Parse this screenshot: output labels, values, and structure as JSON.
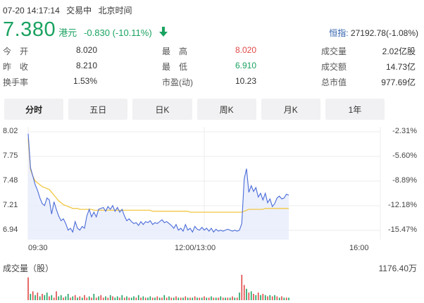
{
  "status": {
    "datetime": "07-20 14:17:14",
    "state": "交易中",
    "timezone": "北京时间"
  },
  "quote": {
    "price": "7.380",
    "currency": "港元",
    "change": "-0.830 (-10.11%)",
    "direction": "down",
    "color_down": "#1aa260"
  },
  "index": {
    "label": "恒指:",
    "value": "27192.78(-1.08%)"
  },
  "stats": {
    "open": {
      "label": "今　开",
      "value": "8.020"
    },
    "prev_close": {
      "label": "昨　收",
      "value": "8.210"
    },
    "turnover_rate": {
      "label": "换手率",
      "value": "1.53%"
    },
    "high": {
      "label": "最　高",
      "value": "8.020"
    },
    "low": {
      "label": "最　低",
      "value": "6.910"
    },
    "pe": {
      "label": "市盈(动)",
      "value": "10.23"
    },
    "volume": {
      "label": "成交量",
      "value": "2.02亿股"
    },
    "amount": {
      "label": "成交额",
      "value": "14.73亿"
    },
    "market_cap": {
      "label": "总市值",
      "value": "977.69亿"
    }
  },
  "tabs": [
    {
      "label": "分时",
      "active": true
    },
    {
      "label": "五日",
      "active": false
    },
    {
      "label": "日K",
      "active": false
    },
    {
      "label": "周K",
      "active": false
    },
    {
      "label": "月K",
      "active": false
    },
    {
      "label": "1年",
      "active": false
    }
  ],
  "chart_data": {
    "type": "line",
    "title": "",
    "x_ticks": [
      "09:30",
      "12:00/13:00",
      "16:00"
    ],
    "y_ticks_left": [
      "8.02",
      "7.75",
      "7.48",
      "7.21",
      "6.94"
    ],
    "y_ticks_right": [
      "-2.31%",
      "-5.60%",
      "-8.89%",
      "-12.18%",
      "-15.47%"
    ],
    "ylim": [
      6.94,
      8.02
    ],
    "colors": {
      "price": "#4a6bd8",
      "average": "#f2c744",
      "fill": "#e7ecfb",
      "vol_up": "#e04848",
      "vol_down": "#1aa260"
    },
    "series": [
      {
        "values": [
          8.0,
          7.64,
          7.55,
          7.46,
          7.4,
          7.32,
          7.26,
          7.24,
          7.32,
          7.3,
          7.15,
          7.28,
          7.2,
          7.13,
          7.08,
          7.1,
          7.05,
          6.98,
          7.0,
          6.96,
          7.07,
          7.0,
          6.98,
          7.02,
          7.0,
          7.13,
          7.2,
          7.12,
          7.17,
          7.12,
          7.2,
          7.21,
          7.22,
          7.18,
          7.23,
          7.2,
          7.24,
          7.18,
          7.22,
          7.17,
          7.2,
          7.13,
          7.08,
          7.1,
          7.07,
          7.05,
          7.06,
          7.03,
          7.07,
          7.04,
          7.07,
          7.06,
          7.08,
          7.04,
          7.06,
          7.05,
          7.07,
          7.09,
          7.06,
          7.07,
          7.05,
          7.03,
          7.0,
          7.04,
          6.98,
          7.0,
          6.97,
          7.04,
          6.98,
          7.0,
          6.96,
          7.02,
          6.99,
          6.98,
          7.01,
          6.98,
          7.0,
          6.97,
          7.0,
          6.96,
          6.99,
          6.97,
          6.98,
          6.97,
          6.98,
          6.99,
          6.98,
          6.97,
          6.98,
          6.97,
          6.98,
          7.05,
          7.52,
          7.63,
          7.38,
          7.45,
          7.39,
          7.43,
          7.33,
          7.37,
          7.3,
          7.37,
          7.27,
          7.31,
          7.23,
          7.26,
          7.32,
          7.34,
          7.31,
          7.32,
          7.36,
          7.35
        ]
      },
      {
        "values": [
          7.95,
          7.62,
          7.55,
          7.5,
          7.48,
          7.46,
          7.44,
          7.43,
          7.42,
          7.41,
          7.38,
          7.35,
          7.32,
          7.29,
          7.27,
          7.25,
          7.24,
          7.23,
          7.22,
          7.21,
          7.21,
          7.21,
          7.2,
          7.2,
          7.2,
          7.2,
          7.2,
          7.2,
          7.19,
          7.19,
          7.19,
          7.19,
          7.19,
          7.19,
          7.19,
          7.19,
          7.19,
          7.19,
          7.19,
          7.19,
          7.19,
          7.19,
          7.19,
          7.19,
          7.19,
          7.19,
          7.19,
          7.19,
          7.19,
          7.19,
          7.19,
          7.19,
          7.19,
          7.18,
          7.18,
          7.18,
          7.18,
          7.18,
          7.18,
          7.18,
          7.18,
          7.18,
          7.18,
          7.18,
          7.18,
          7.18,
          7.18,
          7.18,
          7.18,
          7.17,
          7.17,
          7.17,
          7.17,
          7.17,
          7.17,
          7.17,
          7.17,
          7.17,
          7.17,
          7.17,
          7.17,
          7.17,
          7.17,
          7.17,
          7.17,
          7.17,
          7.17,
          7.17,
          7.17,
          7.17,
          7.17,
          7.17,
          7.18,
          7.19,
          7.2,
          7.2,
          7.2,
          7.2,
          7.2,
          7.2,
          7.2,
          7.21,
          7.21,
          7.21,
          7.21,
          7.21,
          7.21,
          7.21,
          7.21,
          7.21,
          7.21,
          7.21
        ]
      }
    ]
  },
  "volume": {
    "label": "成交量（股）",
    "max_label": "1176.40万",
    "bars": [
      0.9,
      0.25,
      0.35,
      0.2,
      0.3,
      0.15,
      0.25,
      0.2,
      0.3,
      0.15,
      0.2,
      0.1,
      0.35,
      0.15,
      0.2,
      0.1,
      0.15,
      0.25,
      0.1,
      0.15,
      0.2,
      0.1,
      0.15,
      0.1,
      0.2,
      0.1,
      0.15,
      0.1,
      0.25,
      0.1,
      0.15,
      0.2,
      0.1,
      0.15,
      0.1,
      0.2,
      0.15,
      0.1,
      0.15,
      0.1,
      0.2,
      0.1,
      0.15,
      0.1,
      0.1,
      0.15,
      0.1,
      0.2,
      0.1,
      0.15,
      0.1,
      0.1,
      0.15,
      0.1,
      0.1,
      0.15,
      0.1,
      0.1,
      0.2,
      0.1,
      0.15,
      0.1,
      0.1,
      0.15,
      0.1,
      0.1,
      0.1,
      0.15,
      0.1,
      0.1,
      0.1,
      0.15,
      0.1,
      0.1,
      0.1,
      0.15,
      0.1,
      0.1,
      0.15,
      0.1,
      0.1,
      0.1,
      0.15,
      0.1,
      0.1,
      0.1,
      0.1,
      0.15,
      0.1,
      0.1,
      0.3,
      1.0,
      0.6,
      0.45,
      0.3,
      0.35,
      0.25,
      0.2,
      0.3,
      0.2,
      0.25,
      0.2,
      0.15,
      0.2,
      0.15,
      0.2,
      0.15,
      0.1,
      0.15,
      0.1,
      0.1,
      0.1
    ],
    "up": [
      1,
      0,
      1,
      0,
      1,
      0,
      1,
      0,
      0,
      1,
      0,
      1,
      1,
      0,
      0,
      1,
      0,
      0,
      1,
      0,
      1,
      0,
      1,
      0,
      1,
      1,
      0,
      1,
      0,
      1,
      0,
      1,
      1,
      0,
      1,
      0,
      1,
      0,
      0,
      1,
      0,
      1,
      0,
      1,
      0,
      0,
      1,
      0,
      1,
      0,
      1,
      0,
      0,
      1,
      0,
      1,
      0,
      1,
      0,
      1,
      0,
      1,
      0,
      1,
      0,
      1,
      0,
      1,
      0,
      1,
      0,
      1,
      0,
      1,
      0,
      1,
      0,
      1,
      0,
      1,
      0,
      1,
      0,
      1,
      0,
      1,
      0,
      1,
      0,
      1,
      0,
      1,
      1,
      0,
      1,
      0,
      1,
      0,
      1,
      0,
      1,
      0,
      1,
      0,
      1,
      0,
      1,
      0,
      1,
      0,
      1,
      0
    ]
  }
}
